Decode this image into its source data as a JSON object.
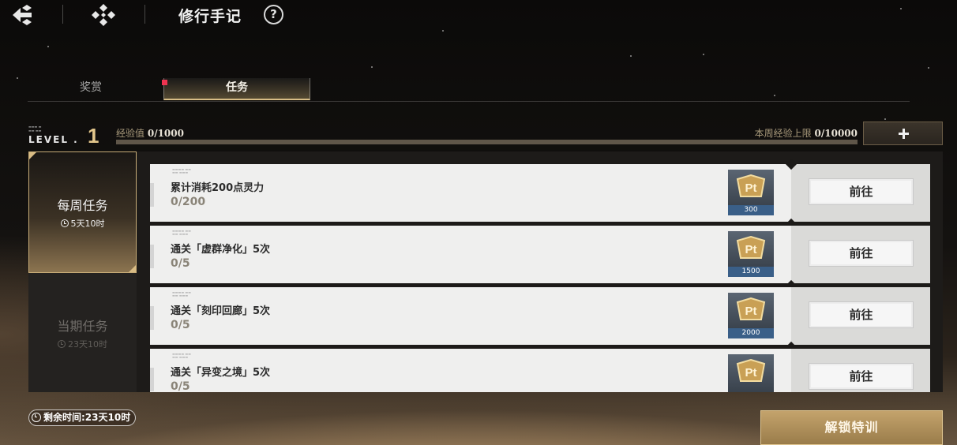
{
  "header": {
    "title": "修行手记",
    "back_icon": "back-arrow-icon",
    "home_icon": "home-diamond-icon",
    "help_label": "?"
  },
  "tabs": [
    {
      "label": "奖赏",
      "active": false
    },
    {
      "label": "任务",
      "active": true,
      "has_notification": true
    }
  ],
  "level": {
    "label": "LEVEL .",
    "value": "1",
    "exp_label": "经验值",
    "exp_value": "0/1000",
    "exp_fraction": 0,
    "weekly_cap_label": "本周经验上限",
    "weekly_cap_value": "0/10000",
    "plus_icon": "plus-icon"
  },
  "categories": [
    {
      "title": "每周任务",
      "timer": "5天10时",
      "active": true
    },
    {
      "title": "当期任务",
      "timer": "23天10时",
      "active": false
    }
  ],
  "tasks": [
    {
      "name": "累计消耗200点灵力",
      "progress": "0/200",
      "reward_icon": "pt-icon",
      "reward": "300",
      "button": "前往"
    },
    {
      "name": "通关「虚群净化」5次",
      "progress": "0/5",
      "reward_icon": "pt-icon",
      "reward": "1500",
      "button": "前往"
    },
    {
      "name": "通关「刻印回廊」5次",
      "progress": "0/5",
      "reward_icon": "pt-icon",
      "reward": "2000",
      "button": "前往"
    },
    {
      "name": "通关「异变之境」5次",
      "progress": "0/5",
      "reward_icon": "pt-icon",
      "reward": "",
      "button": "前往"
    }
  ],
  "footer": {
    "remaining_label": "剩余时间:23天10时",
    "unlock_button": "解锁特训"
  },
  "colors": {
    "accent_gold": "#d6b67a",
    "notification": "#ee3350",
    "reward_blue": "#3a5f88"
  }
}
